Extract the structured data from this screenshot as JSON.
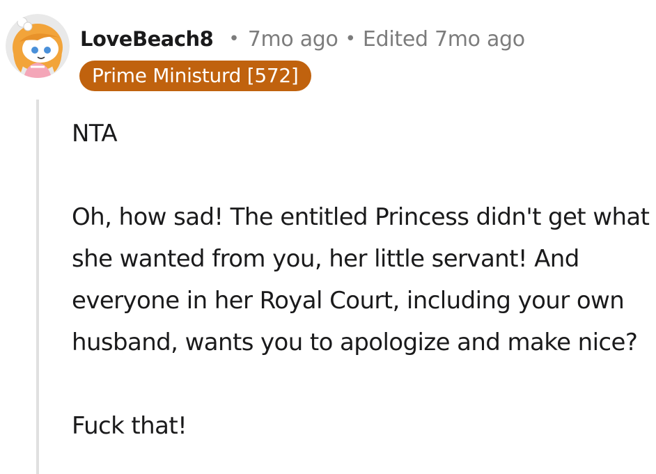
{
  "comment": {
    "avatar_icon": "snoo-avatar-icon",
    "username": "LoveBeach8",
    "separator": "•",
    "timestamp": "7mo ago",
    "edited": "Edited 7mo ago",
    "flair": "Prime Ministurd [572]",
    "flair_color": "#c0620e",
    "paragraphs": [
      "NTA",
      "Oh, how sad! The entitled Princess didn't get what she wanted from you, her little servant! And everyone in her Royal Court, including your own husband, wants you to apologize and make nice?",
      "Fuck that!"
    ]
  }
}
